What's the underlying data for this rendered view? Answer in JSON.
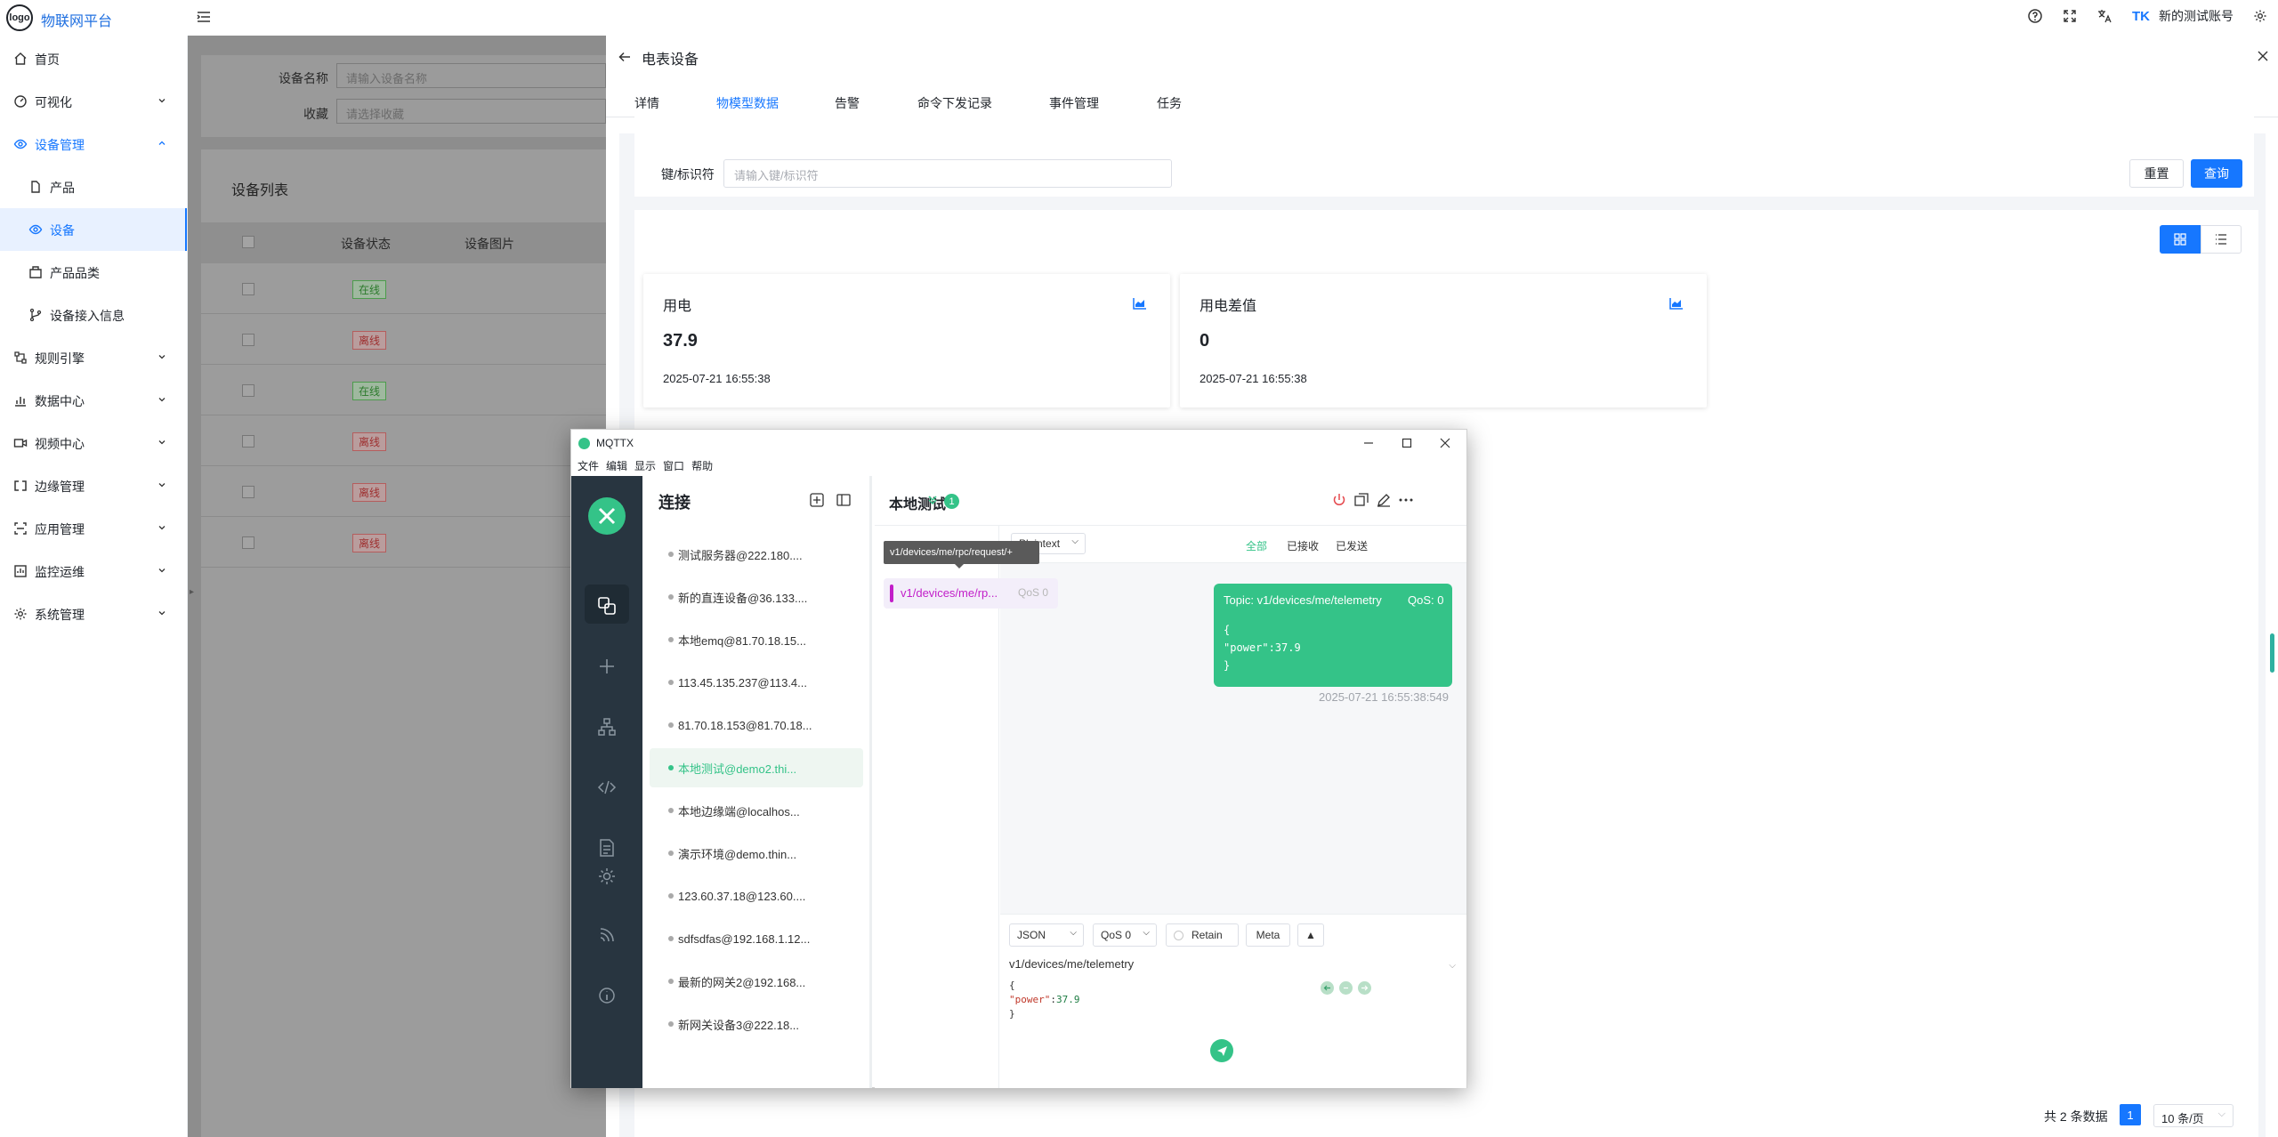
{
  "app": {
    "logo_text": "logo",
    "brand": "物联网平台",
    "account": "新的测试账号",
    "tk_logo": "TK"
  },
  "sidebar": {
    "items": [
      {
        "label": "首页"
      },
      {
        "label": "可视化"
      },
      {
        "label": "设备管理"
      },
      {
        "label": "产品"
      },
      {
        "label": "设备"
      },
      {
        "label": "产品品类"
      },
      {
        "label": "设备接入信息"
      },
      {
        "label": "规则引擎"
      },
      {
        "label": "数据中心"
      },
      {
        "label": "视频中心"
      },
      {
        "label": "边缘管理"
      },
      {
        "label": "应用管理"
      },
      {
        "label": "监控运维"
      },
      {
        "label": "系统管理"
      }
    ]
  },
  "background": {
    "device_name_label": "设备名称",
    "device_name_placeholder": "请输入设备名称",
    "favorite_label": "收藏",
    "favorite_placeholder": "请选择收藏",
    "list_title": "设备列表",
    "columns": [
      "设备状态",
      "设备图片"
    ],
    "rows": [
      {
        "status": "在线",
        "state": "on"
      },
      {
        "status": "离线",
        "state": "off"
      },
      {
        "status": "在线",
        "state": "on"
      },
      {
        "status": "离线",
        "state": "off"
      },
      {
        "status": "离线",
        "state": "off"
      },
      {
        "status": "离线",
        "state": "off"
      }
    ]
  },
  "drawer": {
    "title": "电表设备",
    "tabs": [
      "详情",
      "物模型数据",
      "告警",
      "命令下发记录",
      "事件管理",
      "任务"
    ],
    "active_tab": "物模型数据",
    "filter": {
      "label": "键/标识符",
      "placeholder": "请输入键/标识符",
      "reset": "重置",
      "query": "查询"
    },
    "metrics": [
      {
        "title": "用电",
        "value": "37.9",
        "time": "2025-07-21 16:55:38"
      },
      {
        "title": "用电差值",
        "value": "0",
        "time": "2025-07-21 16:55:38"
      }
    ],
    "pagination": {
      "total": "共 2 条数据",
      "current": "1",
      "page_size": "10 条/页"
    }
  },
  "mqttx": {
    "window_title": "MQTTX",
    "menu": [
      "文件",
      "编辑",
      "显示",
      "窗口",
      "帮助"
    ],
    "connections_title": "连接",
    "connections": [
      "测试服务器@222.180....",
      "新的直连设备@36.133....",
      "本地emq@81.70.18.15...",
      "113.45.135.237@113.4...",
      "81.70.18.153@81.70.18...",
      "本地测试@demo2.thi...",
      "本地边缘端@localhos...",
      "演示环境@demo.thin...",
      "123.60.37.18@123.60....",
      "sdfsdfas@192.168.1.12...",
      "最新的网关2@192.168...",
      "新网关设备3@222.18..."
    ],
    "active_connection": "本地测试",
    "active_badge": "1",
    "tooltip": "v1/devices/me/rpc/request/+",
    "subscription": {
      "topic": "v1/devices/me/rp...",
      "qos": "QoS 0"
    },
    "payload_format": "Plaintext",
    "filters": [
      "全部",
      "已接收",
      "已发送"
    ],
    "message": {
      "topic": "Topic: v1/devices/me/telemetry",
      "qos": "QoS: 0",
      "body": "{\n\"power\":37.9\n}",
      "time": "2025-07-21 16:55:38:549"
    },
    "publish": {
      "format": "JSON",
      "qos": "QoS 0",
      "retain": "Retain",
      "meta": "Meta",
      "topic": "v1/devices/me/telemetry",
      "body_key": "\"power\"",
      "body_value": "37.9"
    }
  },
  "colors": {
    "accent": "#1677ff",
    "mqttx_green": "#34c388",
    "mqttx_rail": "#283540",
    "sub_magenta": "#c21fc9"
  }
}
